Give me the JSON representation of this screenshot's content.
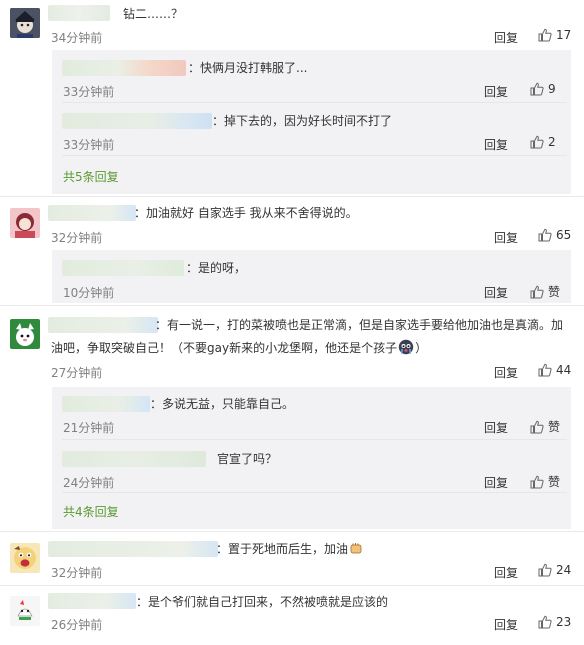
{
  "comments": [
    {
      "text": "钻二……？",
      "time": "34分钟前",
      "reply_label": "回复",
      "likes": "17",
      "replies": [
        {
          "text": "：快俩月没打韩服了...",
          "time": "33分钟前",
          "reply_label": "回复",
          "likes": "9"
        },
        {
          "text": "：掉下去的，因为好长时间不打了",
          "time": "33分钟前",
          "reply_label": "回复",
          "likes": "2"
        }
      ],
      "more": "共5条回复"
    },
    {
      "text": "：加油就好  自家选手 我从来不舍得说的。",
      "time": "32分钟前",
      "reply_label": "回复",
      "likes": "65",
      "replies": [
        {
          "text": "：是的呀，",
          "time": "10分钟前",
          "reply_label": "回复",
          "likes": "赞"
        }
      ]
    },
    {
      "text_line1": "：有一说一，打的菜被喷也是正常滴，但是自家选手要给他加油也是真滴。加",
      "text_line2": "油吧，争取突破自己！（不要gay新来的小龙堡啊，他还是个孩子",
      "text_line2_end": "）",
      "time": "27分钟前",
      "reply_label": "回复",
      "likes": "44",
      "replies": [
        {
          "text": "：多说无益，只能靠自己。",
          "time": "21分钟前",
          "reply_label": "回复",
          "likes": "赞"
        },
        {
          "text": "官宣了吗？",
          "time": "24分钟前",
          "reply_label": "回复",
          "likes": "赞"
        }
      ],
      "more": "共4条回复"
    },
    {
      "text": "：置于死地而后生，加油",
      "time": "32分钟前",
      "reply_label": "回复",
      "likes": "24"
    },
    {
      "text": "：是个爷们就自己打回来，不然被喷就是应该的",
      "time": "26分钟前",
      "reply_label": "回复",
      "likes": "23"
    }
  ],
  "colors": {
    "link_green": "#5a9a32",
    "sub_bg": "#f2f2f5",
    "time_gray": "#808080"
  }
}
